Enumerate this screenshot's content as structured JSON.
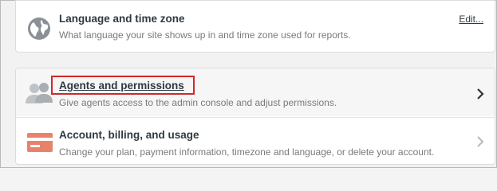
{
  "settings": {
    "language": {
      "title": "Language and time zone",
      "description": "What language your site shows up in and time zone used for reports.",
      "action_label": "Edit..."
    },
    "agents": {
      "title": "Agents and permissions",
      "description": "Give agents access to the admin console and adjust permissions."
    },
    "billing": {
      "title": "Account, billing, and usage",
      "description": "Change your plan, payment information, timezone and language, or delete your account."
    }
  },
  "icons": {
    "language": "globe-icon",
    "agents": "users-icon",
    "billing": "credit-card-icon",
    "chevron": "chevron-right-icon"
  },
  "colors": {
    "highlight": "#d0282a",
    "card_icon": "#e8826b",
    "globe_icon": "#8a9096"
  }
}
